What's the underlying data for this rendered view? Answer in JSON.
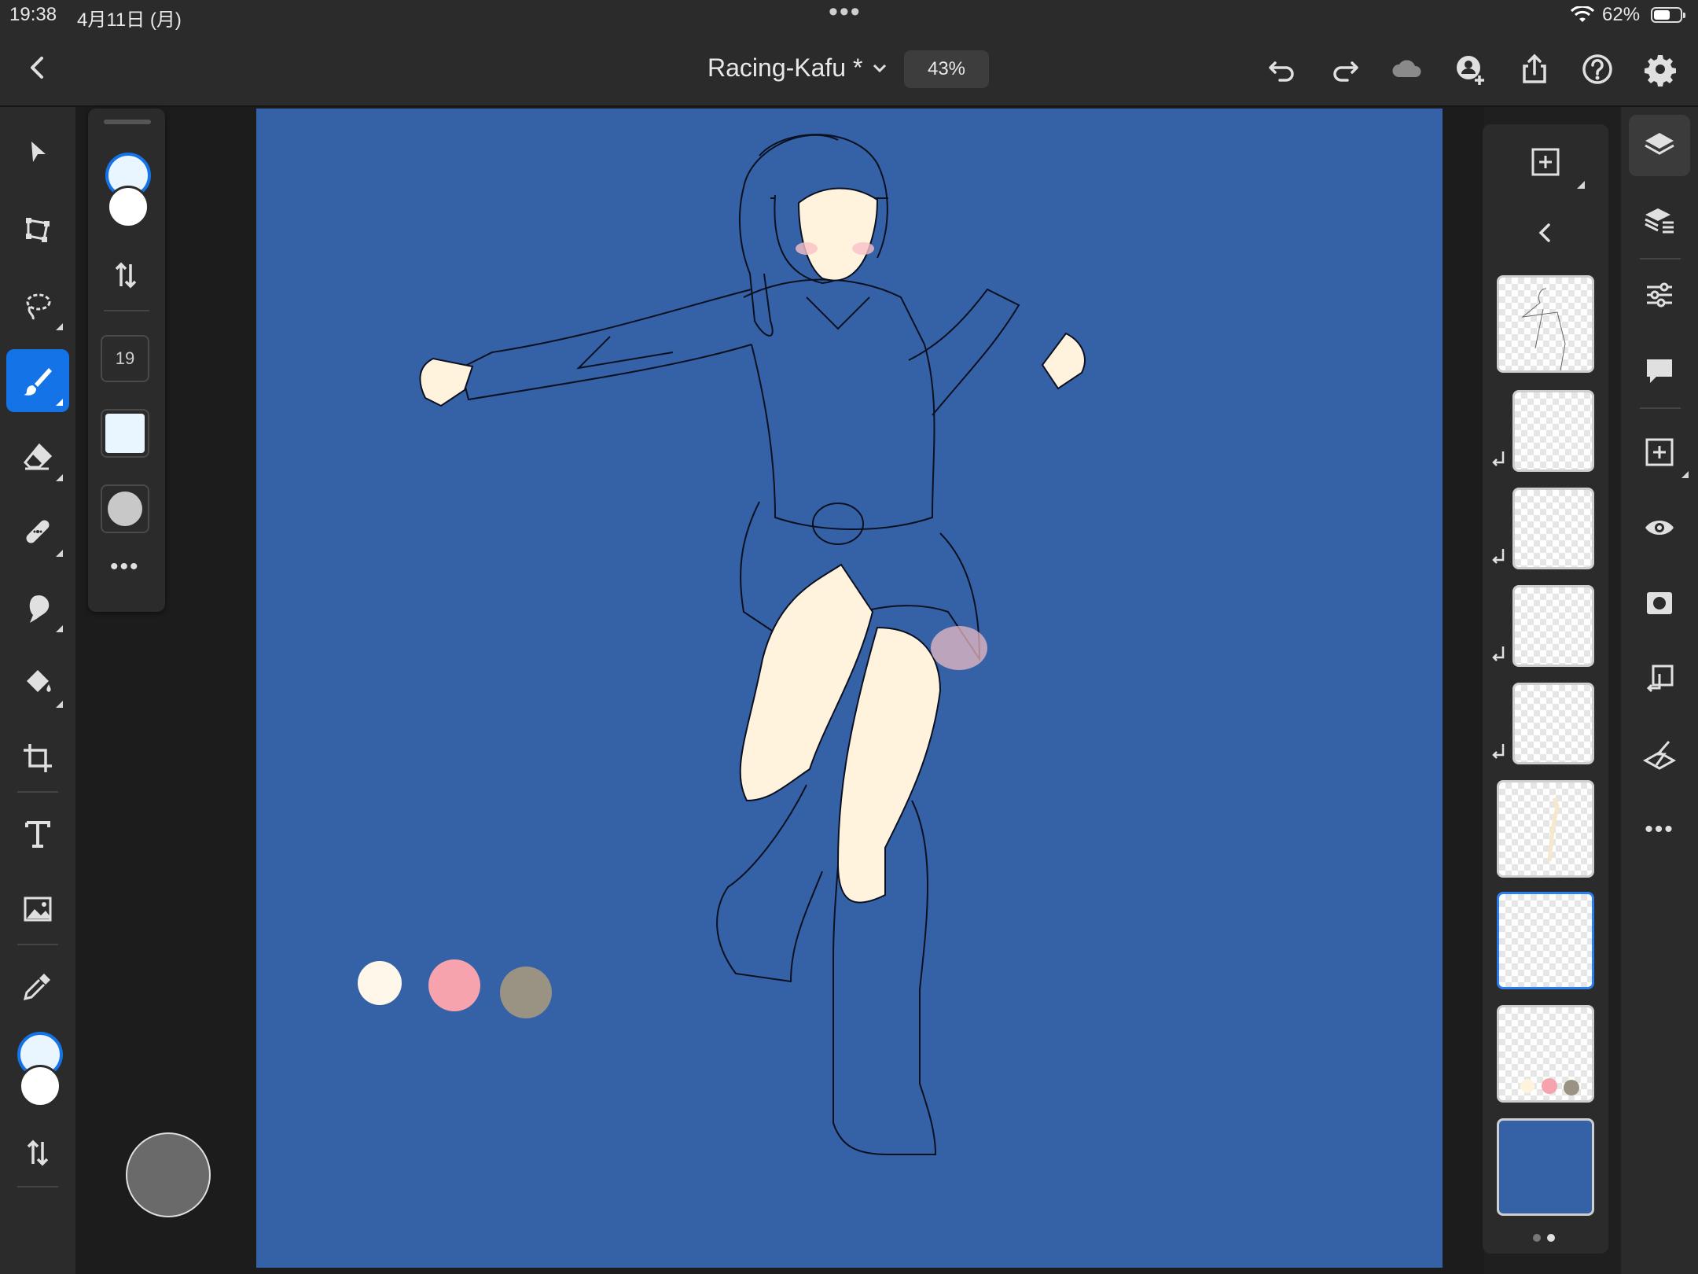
{
  "status_bar": {
    "time": "19:38",
    "date": "4月11日 (月)",
    "battery_pct": "62%",
    "battery_level": 0.62
  },
  "top_bar": {
    "document_title": "Racing-Kafu *",
    "zoom": "43%"
  },
  "left_toolbar": {
    "tools": [
      "select-icon",
      "transform-icon",
      "lasso-icon",
      "brush-icon",
      "eraser-icon",
      "healing-icon",
      "smudge-icon",
      "fill-icon",
      "crop-icon",
      "text-icon",
      "image-icon",
      "eyedropper-icon"
    ],
    "active_tool": "brush-icon",
    "foreground_color": "#e9f6ff",
    "background_color": "#ffffff"
  },
  "brush_panel": {
    "brush_size": "19",
    "brush_color": "#e9f6ff"
  },
  "canvas": {
    "background_color": "#3562a7",
    "palette_swatches": [
      "#fff8ea",
      "#f7a3ad",
      "#9a9283"
    ]
  },
  "layers_panel": {
    "layer_count": 9,
    "selected_index": 6,
    "clipped_layers": [
      1,
      2,
      3,
      4
    ]
  },
  "right_toolbar": {
    "items": [
      "layers-icon",
      "layer-properties-icon",
      "adjustments-icon",
      "comments-icon",
      "add-layer-icon",
      "visibility-icon",
      "mask-icon",
      "clipping-mask-icon",
      "merge-icon",
      "more-icon"
    ]
  }
}
